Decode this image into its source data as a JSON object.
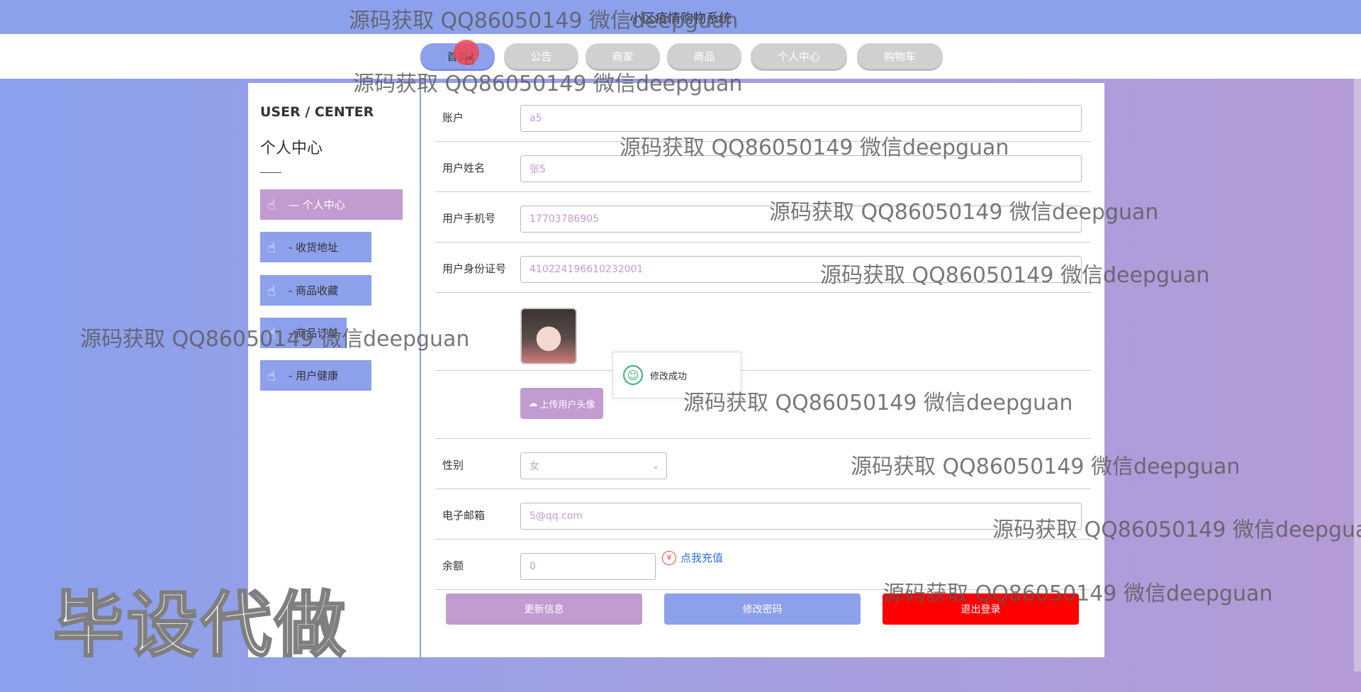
{
  "site": {
    "title": "小区疫情购物系统"
  },
  "nav": [
    {
      "label": "首页",
      "active": true
    },
    {
      "label": "公告",
      "active": false
    },
    {
      "label": "商家",
      "active": false
    },
    {
      "label": "商品",
      "active": false
    },
    {
      "label": "个人中心",
      "active": false
    },
    {
      "label": "购物车",
      "active": false
    }
  ],
  "sidebar": {
    "title_en": "USER / CENTER",
    "title_cn": "个人中心",
    "items": [
      {
        "label": "— 个人中心",
        "icon": "hand-wave-icon",
        "active": true
      },
      {
        "label": "- 收货地址",
        "icon": "hand-wave-icon",
        "active": false
      },
      {
        "label": "- 商品收藏",
        "icon": "hand-wave-icon",
        "active": false
      },
      {
        "label": "- 商品订单",
        "icon": "hand-wave-icon",
        "active": false
      },
      {
        "label": "- 用户健康",
        "icon": "hand-wave-icon",
        "active": false
      }
    ]
  },
  "form": {
    "account": {
      "label": "账户",
      "value": "a5"
    },
    "name": {
      "label": "用户姓名",
      "value": "张5"
    },
    "phone": {
      "label": "用户手机号",
      "value": "17703786905"
    },
    "idcard": {
      "label": "用户身份证号",
      "value": "410224196610232001"
    },
    "upload_label": "上传用户头像",
    "gender": {
      "label": "性别",
      "value": "女"
    },
    "email": {
      "label": "电子邮箱",
      "value": "5@qq.com"
    },
    "balance": {
      "label": "余额",
      "value": "0",
      "recharge": "点我充值"
    }
  },
  "toast": {
    "message": "修改成功"
  },
  "actions": {
    "update": "更新信息",
    "password": "修改密码",
    "logout": "退出登录"
  },
  "overlay": {
    "watermark": "源码获取 QQ86050149 微信deepguan",
    "stamp": "毕设代做"
  },
  "colors": {
    "primary": "#8da0ec",
    "accent": "#c29bd0",
    "danger": "#ff0000"
  }
}
